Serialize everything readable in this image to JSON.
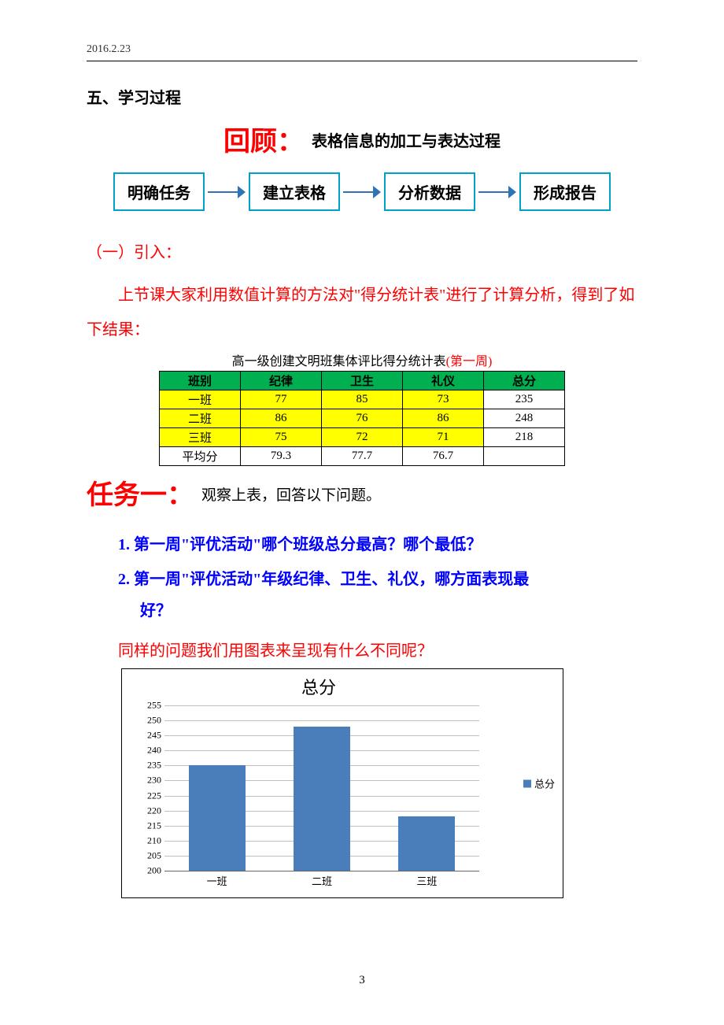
{
  "header": {
    "date": "2016.2.23"
  },
  "section5": {
    "title": "五、学习过程"
  },
  "review": {
    "big": "回顾：",
    "small": "表格信息的加工与表达过程"
  },
  "flow": {
    "steps": [
      "明确任务",
      "建立表格",
      "分析数据",
      "形成报告"
    ]
  },
  "sub1": {
    "title": "（一）引入："
  },
  "intro": {
    "text": "上节课大家利用数值计算的方法对\"得分统计表\"进行了计算分析，得到了如下结果："
  },
  "table": {
    "title": "高一级创建文明班集体评比得分统计表",
    "week": "(第一周)",
    "headers": [
      "班别",
      "纪律",
      "卫生",
      "礼仪",
      "总分"
    ],
    "rows": [
      {
        "class": "一班",
        "discipline": "77",
        "hygiene": "85",
        "etiquette": "73",
        "total": "235"
      },
      {
        "class": "二班",
        "discipline": "86",
        "hygiene": "76",
        "etiquette": "86",
        "total": "248"
      },
      {
        "class": "三班",
        "discipline": "75",
        "hygiene": "72",
        "etiquette": "71",
        "total": "218"
      }
    ],
    "avg_row": {
      "label": "平均分",
      "discipline": "79.3",
      "hygiene": "77.7",
      "etiquette": "76.7",
      "total": ""
    }
  },
  "task1": {
    "big": "任务一：",
    "small": "观察上表，回答以下问题。"
  },
  "questions": {
    "q1": "1. 第一周\"评优活动\"哪个班级总分最高？哪个最低？",
    "q2a": "2. 第一周\"评优活动\"年级纪律、卫生、礼仪，哪方面表现最",
    "q2b": "好？"
  },
  "same_q": {
    "text": "同样的问题我们用图表来呈现有什么不同呢？"
  },
  "chart_data": {
    "type": "bar",
    "title": "总分",
    "categories": [
      "一班",
      "二班",
      "三班"
    ],
    "values": [
      235,
      248,
      218
    ],
    "series_name": "总分",
    "ylabel": "",
    "xlabel": "",
    "ylim": [
      200,
      255
    ],
    "ytick_step": 5,
    "yticks": [
      200,
      205,
      210,
      215,
      220,
      225,
      230,
      235,
      240,
      245,
      250,
      255
    ]
  },
  "legend": {
    "label": "总分"
  },
  "page_number": "3"
}
